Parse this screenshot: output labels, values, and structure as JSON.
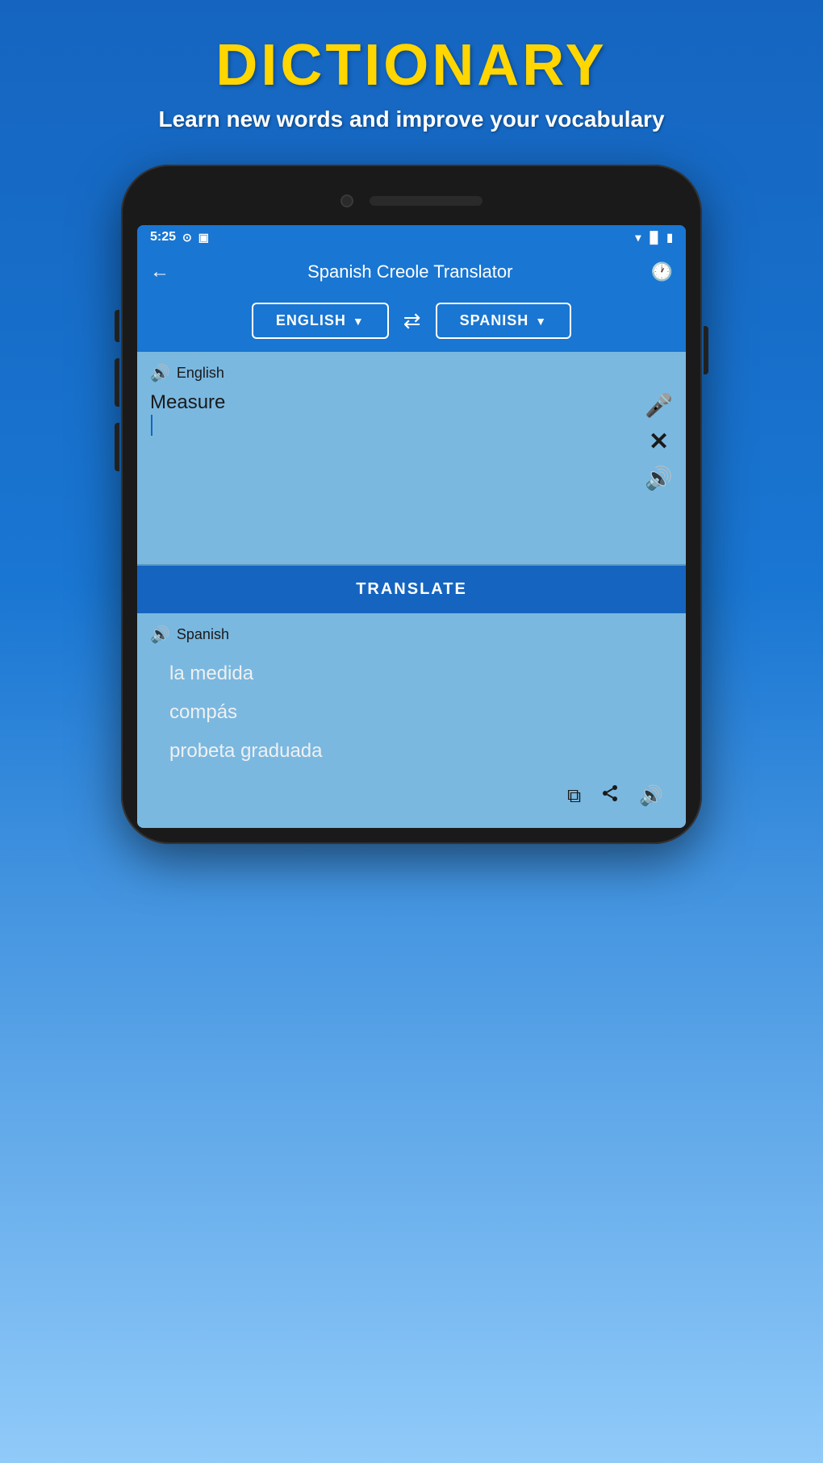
{
  "header": {
    "title": "DICTIONARY",
    "subtitle": "Learn new words and improve your vocabulary"
  },
  "status_bar": {
    "time": "5:25",
    "icons": [
      "media",
      "sim",
      "wifi",
      "signal",
      "battery"
    ]
  },
  "app_bar": {
    "title": "Spanish Creole Translator",
    "back_label": "←",
    "history_label": "⟳"
  },
  "lang_bar": {
    "source_lang": "ENGLISH",
    "target_lang": "SPANISH",
    "swap_label": "⇄"
  },
  "input_panel": {
    "lang_label": "English",
    "input_text": "Measure",
    "mic_label": "🎤",
    "close_label": "✕",
    "sound_label": "🔊"
  },
  "translate_button": {
    "label": "TRANSLATE"
  },
  "output_panel": {
    "lang_label": "Spanish",
    "translations": [
      "la medida",
      "compás",
      "probeta graduada"
    ],
    "copy_label": "⧉",
    "share_label": "⤴",
    "sound_label": "🔊"
  }
}
